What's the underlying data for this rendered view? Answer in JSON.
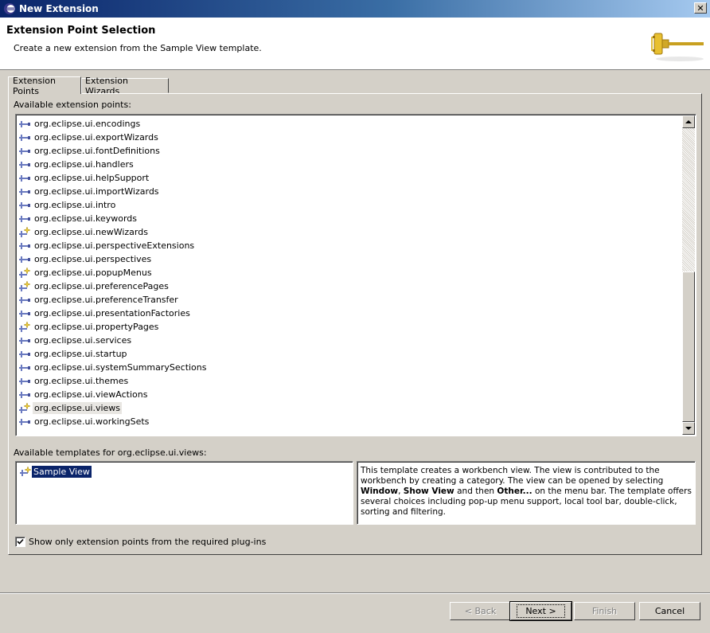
{
  "window": {
    "title": "New Extension"
  },
  "header": {
    "title": "Extension Point Selection",
    "description": "Create a new extension from the Sample View template."
  },
  "tabs": [
    {
      "label": "Extension Points",
      "active": true
    },
    {
      "label": "Extension Wizards",
      "active": false
    }
  ],
  "extension_points": {
    "label": "Available extension points:",
    "items": [
      {
        "label": "org.eclipse.ui.encodings",
        "icon": "extension-point-icon"
      },
      {
        "label": "org.eclipse.ui.exportWizards",
        "icon": "extension-point-icon"
      },
      {
        "label": "org.eclipse.ui.fontDefinitions",
        "icon": "extension-point-icon"
      },
      {
        "label": "org.eclipse.ui.handlers",
        "icon": "extension-point-icon"
      },
      {
        "label": "org.eclipse.ui.helpSupport",
        "icon": "extension-point-icon"
      },
      {
        "label": "org.eclipse.ui.importWizards",
        "icon": "extension-point-icon"
      },
      {
        "label": "org.eclipse.ui.intro",
        "icon": "extension-point-icon"
      },
      {
        "label": "org.eclipse.ui.keywords",
        "icon": "extension-point-icon"
      },
      {
        "label": "org.eclipse.ui.newWizards",
        "icon": "extension-point-template-icon"
      },
      {
        "label": "org.eclipse.ui.perspectiveExtensions",
        "icon": "extension-point-icon"
      },
      {
        "label": "org.eclipse.ui.perspectives",
        "icon": "extension-point-icon"
      },
      {
        "label": "org.eclipse.ui.popupMenus",
        "icon": "extension-point-template-icon"
      },
      {
        "label": "org.eclipse.ui.preferencePages",
        "icon": "extension-point-template-icon"
      },
      {
        "label": "org.eclipse.ui.preferenceTransfer",
        "icon": "extension-point-icon"
      },
      {
        "label": "org.eclipse.ui.presentationFactories",
        "icon": "extension-point-icon"
      },
      {
        "label": "org.eclipse.ui.propertyPages",
        "icon": "extension-point-template-icon"
      },
      {
        "label": "org.eclipse.ui.services",
        "icon": "extension-point-icon"
      },
      {
        "label": "org.eclipse.ui.startup",
        "icon": "extension-point-icon"
      },
      {
        "label": "org.eclipse.ui.systemSummarySections",
        "icon": "extension-point-icon"
      },
      {
        "label": "org.eclipse.ui.themes",
        "icon": "extension-point-icon"
      },
      {
        "label": "org.eclipse.ui.viewActions",
        "icon": "extension-point-icon"
      },
      {
        "label": "org.eclipse.ui.views",
        "icon": "extension-point-template-icon",
        "selected": true
      },
      {
        "label": "org.eclipse.ui.workingSets",
        "icon": "extension-point-icon"
      }
    ]
  },
  "templates": {
    "label": "Available templates for org.eclipse.ui.views:",
    "items": [
      {
        "label": "Sample View",
        "selected": true
      }
    ]
  },
  "description": {
    "parts": [
      {
        "text": "This template creates a workbench view. The view is contributed to the workbench by creating a category. The view can be opened by selecting ",
        "bold": false
      },
      {
        "text": "Window",
        "bold": true
      },
      {
        "text": ", ",
        "bold": false
      },
      {
        "text": "Show View",
        "bold": true
      },
      {
        "text": " and then ",
        "bold": false
      },
      {
        "text": "Other...",
        "bold": true
      },
      {
        "text": " on the menu bar. The template offers several choices including pop-up menu support, local tool bar, double-click, sorting and filtering.",
        "bold": false
      }
    ]
  },
  "filter_checkbox": {
    "label": "Show only extension points from the required plug-ins",
    "checked": true
  },
  "buttons": {
    "back": "< Back",
    "next": "Next >",
    "finish": "Finish",
    "cancel": "Cancel"
  },
  "colors": {
    "selection": "#0a246a",
    "dialog_bg": "#d4d0c8"
  }
}
